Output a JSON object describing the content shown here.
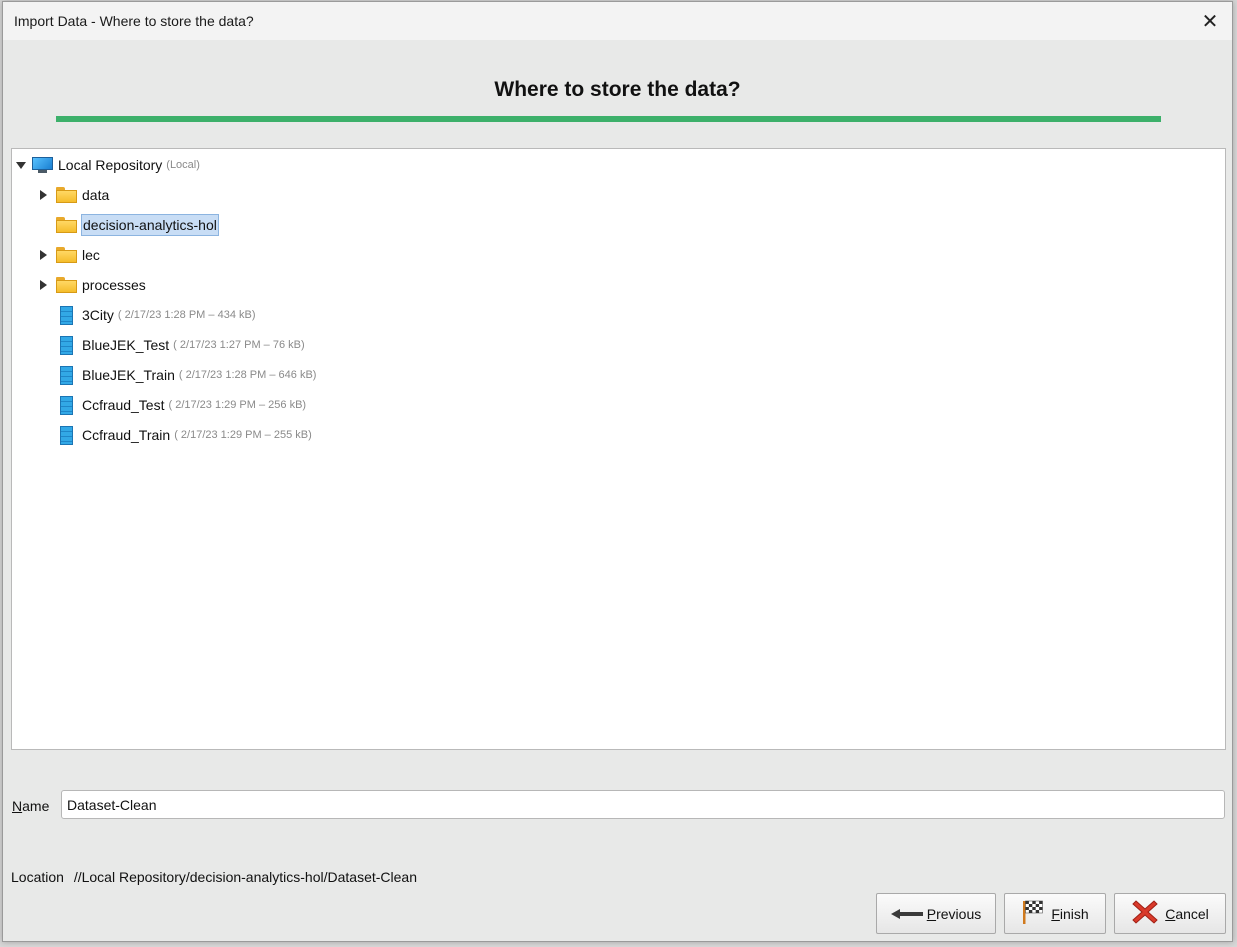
{
  "window": {
    "title": "Import Data - Where to store the data?",
    "close_glyph": "✕"
  },
  "wizard": {
    "heading": "Where to store the data?",
    "accent_color": "#3cb06a"
  },
  "tree": {
    "root": {
      "label": "Local Repository",
      "meta": "(Local)",
      "icon": "monitor-icon",
      "expanded": true
    },
    "folders": [
      {
        "label": "data",
        "icon": "folder-icon",
        "expandable": true
      },
      {
        "label": "decision-analytics-hol",
        "icon": "folder-open-icon",
        "expandable": false,
        "selected": true
      },
      {
        "label": "lec",
        "icon": "folder-icon",
        "expandable": true
      },
      {
        "label": "processes",
        "icon": "folder-icon",
        "expandable": true
      }
    ],
    "entries": [
      {
        "label": "3City",
        "meta": "( 2/17/23 1:28 PM – 434 kB)",
        "icon": "data-icon"
      },
      {
        "label": "BlueJEK_Test",
        "meta": "( 2/17/23 1:27 PM – 76 kB)",
        "icon": "data-icon"
      },
      {
        "label": "BlueJEK_Train",
        "meta": "( 2/17/23 1:28 PM – 646 kB)",
        "icon": "data-icon"
      },
      {
        "label": "Ccfraud_Test",
        "meta": "( 2/17/23 1:29 PM – 256 kB)",
        "icon": "data-icon"
      },
      {
        "label": "Ccfraud_Train",
        "meta": "( 2/17/23 1:29 PM – 255 kB)",
        "icon": "data-icon"
      }
    ]
  },
  "name_field": {
    "label_mnemonic": "N",
    "label_rest": "ame",
    "value": "Dataset-Clean"
  },
  "location": {
    "label": "Location",
    "value": "//Local Repository/decision-analytics-hol/Dataset-Clean"
  },
  "buttons": {
    "previous": {
      "mnemonic": "P",
      "rest": "revious"
    },
    "finish": {
      "mnemonic": "F",
      "rest": "inish"
    },
    "cancel": {
      "mnemonic": "C",
      "rest": "ancel"
    }
  }
}
